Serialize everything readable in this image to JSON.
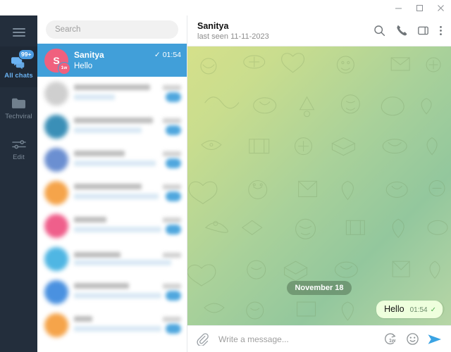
{
  "window": {
    "minimize_label": "Minimize",
    "maximize_label": "Maximize",
    "close_label": "Close"
  },
  "rail": {
    "menu_label": "Menu",
    "items": [
      {
        "label": "All chats",
        "badge": "99+",
        "icon": "chats-icon",
        "active": true
      },
      {
        "label": "Techviral",
        "badge": "",
        "icon": "folder-icon",
        "active": false
      },
      {
        "label": "Edit",
        "badge": "",
        "icon": "sliders-icon",
        "active": false
      }
    ]
  },
  "search": {
    "placeholder": "Search",
    "value": ""
  },
  "chat_list": {
    "selected": {
      "name": "Sanitya",
      "preview": "Hello",
      "time": "01:54",
      "status_check": "✓",
      "avatar_initial": "S",
      "avatar_color": "#f0607e",
      "ttl_badge": "1w"
    },
    "blurred_rows": [
      {
        "avatar_color": "#cfcfcf",
        "name_w": 108,
        "sub_w": 58,
        "badge": true,
        "time_w": 24
      },
      {
        "avatar_color": "#3a8fb7",
        "name_w": 112,
        "sub_w": 96,
        "badge": true,
        "time_w": 26
      },
      {
        "avatar_color": "#6b8fd1",
        "name_w": 72,
        "sub_w": 116,
        "badge": true,
        "time_w": 22
      },
      {
        "avatar_color": "#f5a44a",
        "name_w": 96,
        "sub_w": 120,
        "badge": true,
        "time_w": 20
      },
      {
        "avatar_color": "#ef5f8b",
        "name_w": 46,
        "sub_w": 132,
        "badge": true,
        "time_w": 28
      },
      {
        "avatar_color": "#4fb6e3",
        "name_w": 66,
        "sub_w": 138,
        "badge": false,
        "time_w": 24
      },
      {
        "avatar_color": "#4a91e0",
        "name_w": 78,
        "sub_w": 134,
        "badge": true,
        "time_w": 22
      },
      {
        "avatar_color": "#f5a44a",
        "name_w": 26,
        "sub_w": 128,
        "badge": true,
        "time_w": 18
      }
    ]
  },
  "chat_header": {
    "title": "Sanitya",
    "subtitle": "last seen 11-11-2023",
    "search_label": "Search",
    "call_label": "Call",
    "panel_label": "Toggle info panel",
    "menu_label": "More"
  },
  "conversation": {
    "date_divider": "November 18",
    "messages": [
      {
        "text": "Hello",
        "time": "01:54",
        "status_check": "✓",
        "outgoing": true
      }
    ]
  },
  "composer": {
    "attach_label": "Attach",
    "placeholder": "Write a message...",
    "value": "",
    "ttl_label": "1w",
    "emoji_label": "Emoji",
    "send_label": "Send"
  },
  "colors": {
    "rail_bg": "#232e3c",
    "rail_active_bg": "#1f2936",
    "accent": "#419fd9",
    "selected_row": "#419fd9",
    "badge_blue": "#4c9ce2",
    "bubble_out": "#eeffdd",
    "check_green": "#4fae4e",
    "send_blue": "#3aa3e3"
  }
}
